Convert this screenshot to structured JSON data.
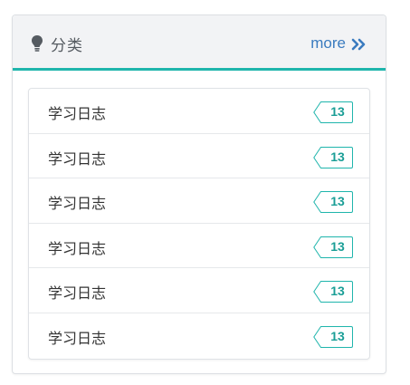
{
  "header": {
    "icon": "lightbulb-icon",
    "title": "分类",
    "more_label": "more",
    "more_icon": "double-chevron-right-icon"
  },
  "colors": {
    "accent": "#1fb5ac",
    "link": "#3a7bbf"
  },
  "categories": [
    {
      "label": "学习日志",
      "count": "13"
    },
    {
      "label": "学习日志",
      "count": "13"
    },
    {
      "label": "学习日志",
      "count": "13"
    },
    {
      "label": "学习日志",
      "count": "13"
    },
    {
      "label": "学习日志",
      "count": "13"
    },
    {
      "label": "学习日志",
      "count": "13"
    }
  ]
}
